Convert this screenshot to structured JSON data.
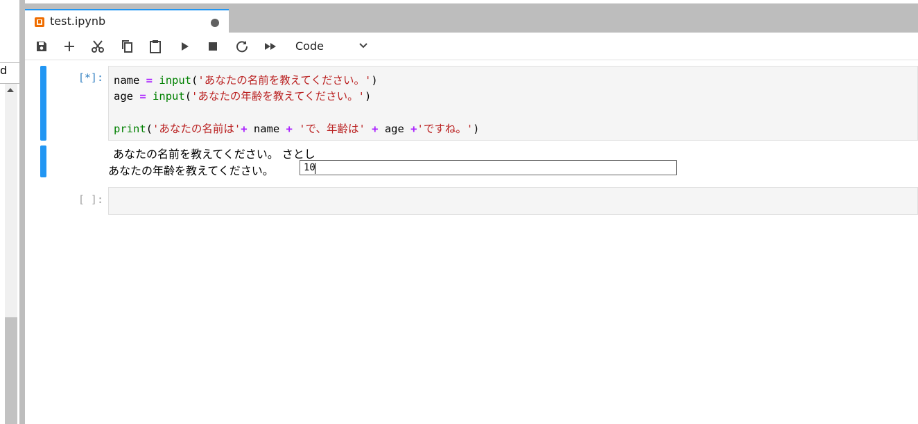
{
  "sidebar": {
    "partial_label": "d"
  },
  "tab": {
    "title": "test.ipynb",
    "dirty": true,
    "accent": "#2196f3",
    "icon": "notebook-icon"
  },
  "toolbar": {
    "buttons": [
      "save-icon",
      "add-cell-icon",
      "cut-icon",
      "copy-icon",
      "paste-icon",
      "run-icon",
      "stop-icon",
      "restart-icon",
      "run-all-icon"
    ],
    "cell_type": "Code"
  },
  "cells": [
    {
      "prompt": "[*]:",
      "code": {
        "line1": {
          "var": "name",
          "op": "=",
          "fn": "input",
          "open": "(",
          "str": "'あなたの名前を教えてください。'",
          "close": ")"
        },
        "line2": {
          "var": "age",
          "op": "=",
          "fn": "input",
          "open": "(",
          "str": "'あなたの年齢を教えてください。'",
          "close": ")"
        },
        "line4": {
          "fn": "print",
          "open": "(",
          "str1": "'あなたの名前は'",
          "op1": "+",
          "v1": "name",
          "op2": "+",
          "str2": "'で、年齢は'",
          "op3": "+",
          "v2": "age",
          "op4": "+",
          "str3": "'ですね。'",
          "close": ")"
        }
      },
      "output": {
        "line1": "あなたの名前を教えてください。 さとし",
        "prompt2": "あなたの年齢を教えてください。",
        "input_value": "10"
      }
    },
    {
      "prompt": "[ ]:"
    }
  ]
}
